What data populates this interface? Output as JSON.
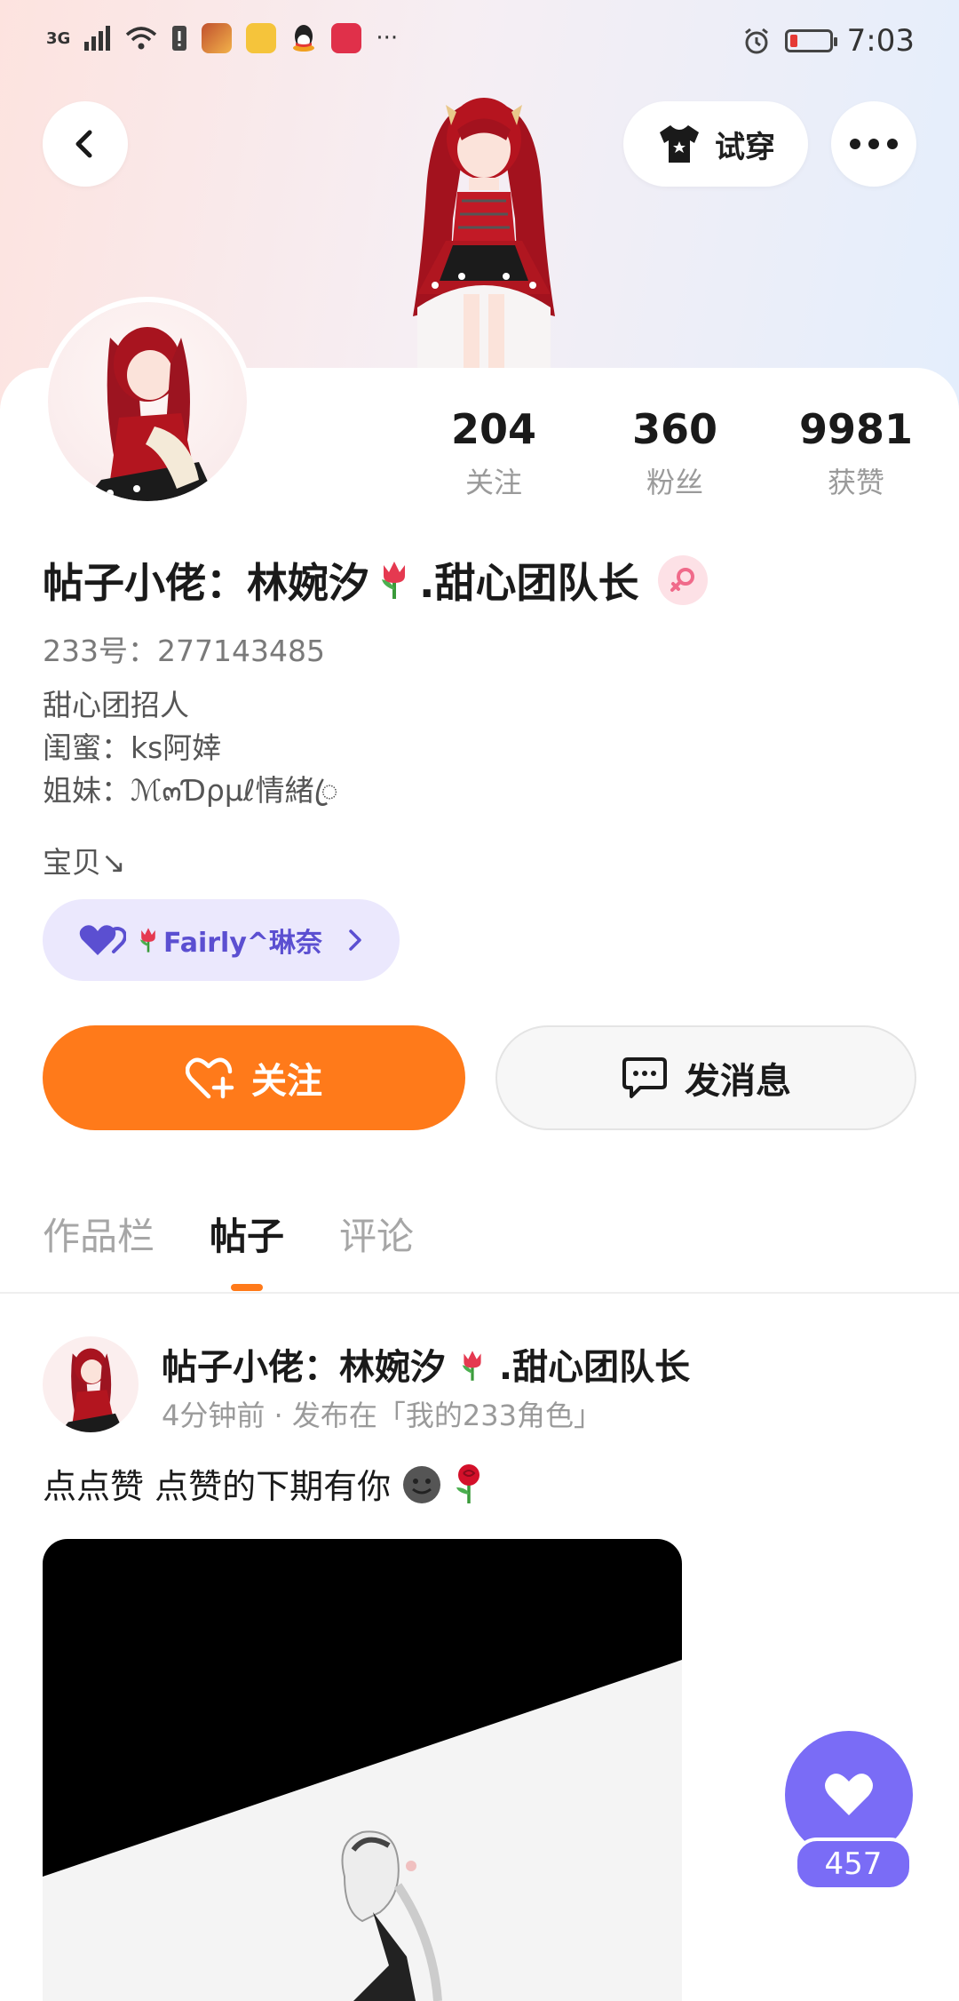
{
  "status_bar": {
    "network": "3G",
    "time": "7:03",
    "more": "···"
  },
  "header": {
    "tryon_label": "试穿"
  },
  "stats": [
    {
      "value": "204",
      "label": "关注"
    },
    {
      "value": "360",
      "label": "粉丝"
    },
    {
      "value": "9981",
      "label": "获赞"
    }
  ],
  "profile": {
    "name_part1": "帖子小佬：林婉汐",
    "name_part2": ".甜心团队长",
    "uid": "233号：277143485",
    "bio_lines": [
      "甜心团招人",
      "闺蜜：ks阿婞",
      "姐妹：ℳ๓Ɗρμℓ情緒ꦿ"
    ],
    "baby": "宝贝↘",
    "cp_name": "Fairly^琳奈"
  },
  "actions": {
    "follow_label": "关注",
    "message_label": "发消息"
  },
  "tabs": [
    {
      "label": "作品栏",
      "active": false
    },
    {
      "label": "帖子",
      "active": true
    },
    {
      "label": "评论",
      "active": false
    }
  ],
  "post": {
    "author_part1": "帖子小佬：林婉汐",
    "author_part2": ".甜心团队长",
    "meta": "4分钟前 · 发布在「我的233角色」",
    "text": "点点赞  点赞的下期有你"
  },
  "like": {
    "count": "457"
  },
  "colors": {
    "accent_orange": "#ff7a1a",
    "like_purple": "#7a6cf6",
    "cp_pill_bg": "#ebe8fd",
    "cp_text": "#5b4fd1"
  }
}
